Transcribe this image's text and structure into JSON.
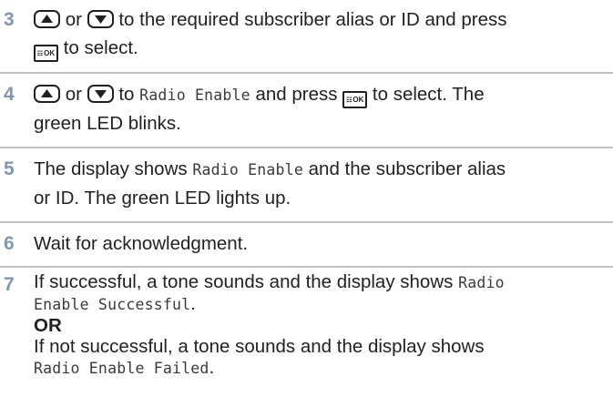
{
  "steps": [
    {
      "number": "3",
      "or_word": "or",
      "text_after_keys": "to the required subscriber alias or ID and press",
      "text_after_ok": "to select."
    },
    {
      "number": "4",
      "or_word": "or",
      "to_word": "to",
      "mono_1": "Radio Enable",
      "text_mid": "and press",
      "text_after_ok": "to select. The",
      "line2": "green LED blinks."
    },
    {
      "number": "5",
      "text_1": "The display shows",
      "mono_1": "Radio Enable",
      "text_2": "and the subscriber alias",
      "line2": "or ID. The green LED lights up."
    },
    {
      "number": "6",
      "text": "Wait for acknowledgment."
    },
    {
      "number": "7",
      "line1": "If successful, a tone sounds and the display shows",
      "mono_1a": "Radio",
      "mono_1b": "Enable Successful",
      "period": ".",
      "or_label": "OR",
      "line4": "If not successful, a tone sounds and the display shows",
      "mono_2": "Radio Enable Failed",
      "period2": "."
    }
  ],
  "keys": {
    "up_icon": "up-arrow-key-icon",
    "down_icon": "down-arrow-key-icon",
    "ok_icon": "menu-ok-key-icon",
    "ok_label": "OK",
    "menu_glyph": "☷"
  },
  "colors": {
    "step_number": "#7f97b2",
    "separator": "#bfc3c7",
    "text": "#231f20"
  }
}
